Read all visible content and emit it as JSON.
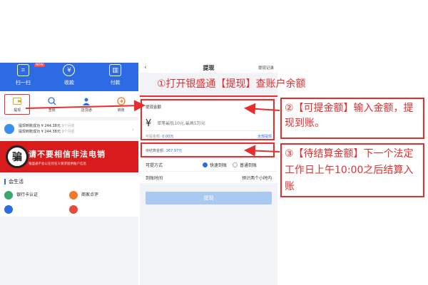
{
  "left_app": {
    "header": {
      "badge": "NEW",
      "items": [
        {
          "label": "扫一扫",
          "icon": "scan-icon"
        },
        {
          "label": "收款",
          "icon": "yen-icon"
        },
        {
          "label": "付款",
          "icon": "barcode-icon"
        }
      ]
    },
    "tiles": [
      {
        "label": "提现",
        "icon": "wallet-icon"
      },
      {
        "label": "查账",
        "icon": "search-icon"
      },
      {
        "label": "店员通",
        "icon": "staff-icon"
      },
      {
        "label": "转账",
        "icon": "transfer-icon"
      }
    ],
    "records": {
      "line1": "提现到账成功 ¥ 244.38元",
      "time1": "9个月前",
      "line2": "提现到账成功 ¥ 244.38元",
      "time2": "9个月前"
    },
    "banner": {
      "icon_char": "骗",
      "title": "请不要相信非法电销",
      "subtitle": "银盛通不会以任何名义要求提供账户信息"
    },
    "life_title": "会生活",
    "services": [
      {
        "name": "银行卡认证",
        "sub": "",
        "color": "#3aa86b"
      },
      {
        "name": "商家点评",
        "sub": "",
        "color": "#f07a2a"
      },
      {
        "name": "",
        "sub": "",
        "color": "#2d6be4"
      },
      {
        "name": "",
        "sub": "",
        "color": "#e64c3c"
      }
    ]
  },
  "withdraw_screen": {
    "back_glyph": "‹",
    "title": "提现",
    "record_link": "提现记录",
    "amount_label": "提现金额",
    "currency": "¥",
    "amount_placeholder": "单笔最低10元,最高5万元",
    "available_label": "可提金额:",
    "available_value": "0.00元",
    "all_link": "全部提现",
    "pending_label": "待结算金额:",
    "pending_value": "267.97元",
    "method_label": "可提方式",
    "method_fast": "快速到账",
    "method_normal": "普通到账",
    "arrive_label": "到账时间",
    "arrive_value": "预计两个小时内",
    "submit_label": "提现"
  },
  "annotations": {
    "step1": "①打开银盛通【提现】查账户余额",
    "step2": "②【可提金额】输入金额，提现到账。",
    "step3": "③【待结算金额】下一个法定工作日上午10:00之后结算入账"
  },
  "colors": {
    "brand_blue": "#2d6be4",
    "annotation_red": "#e62e2e",
    "banner_red": "#d81b1b",
    "button_disabled": "#a9c8f2"
  }
}
